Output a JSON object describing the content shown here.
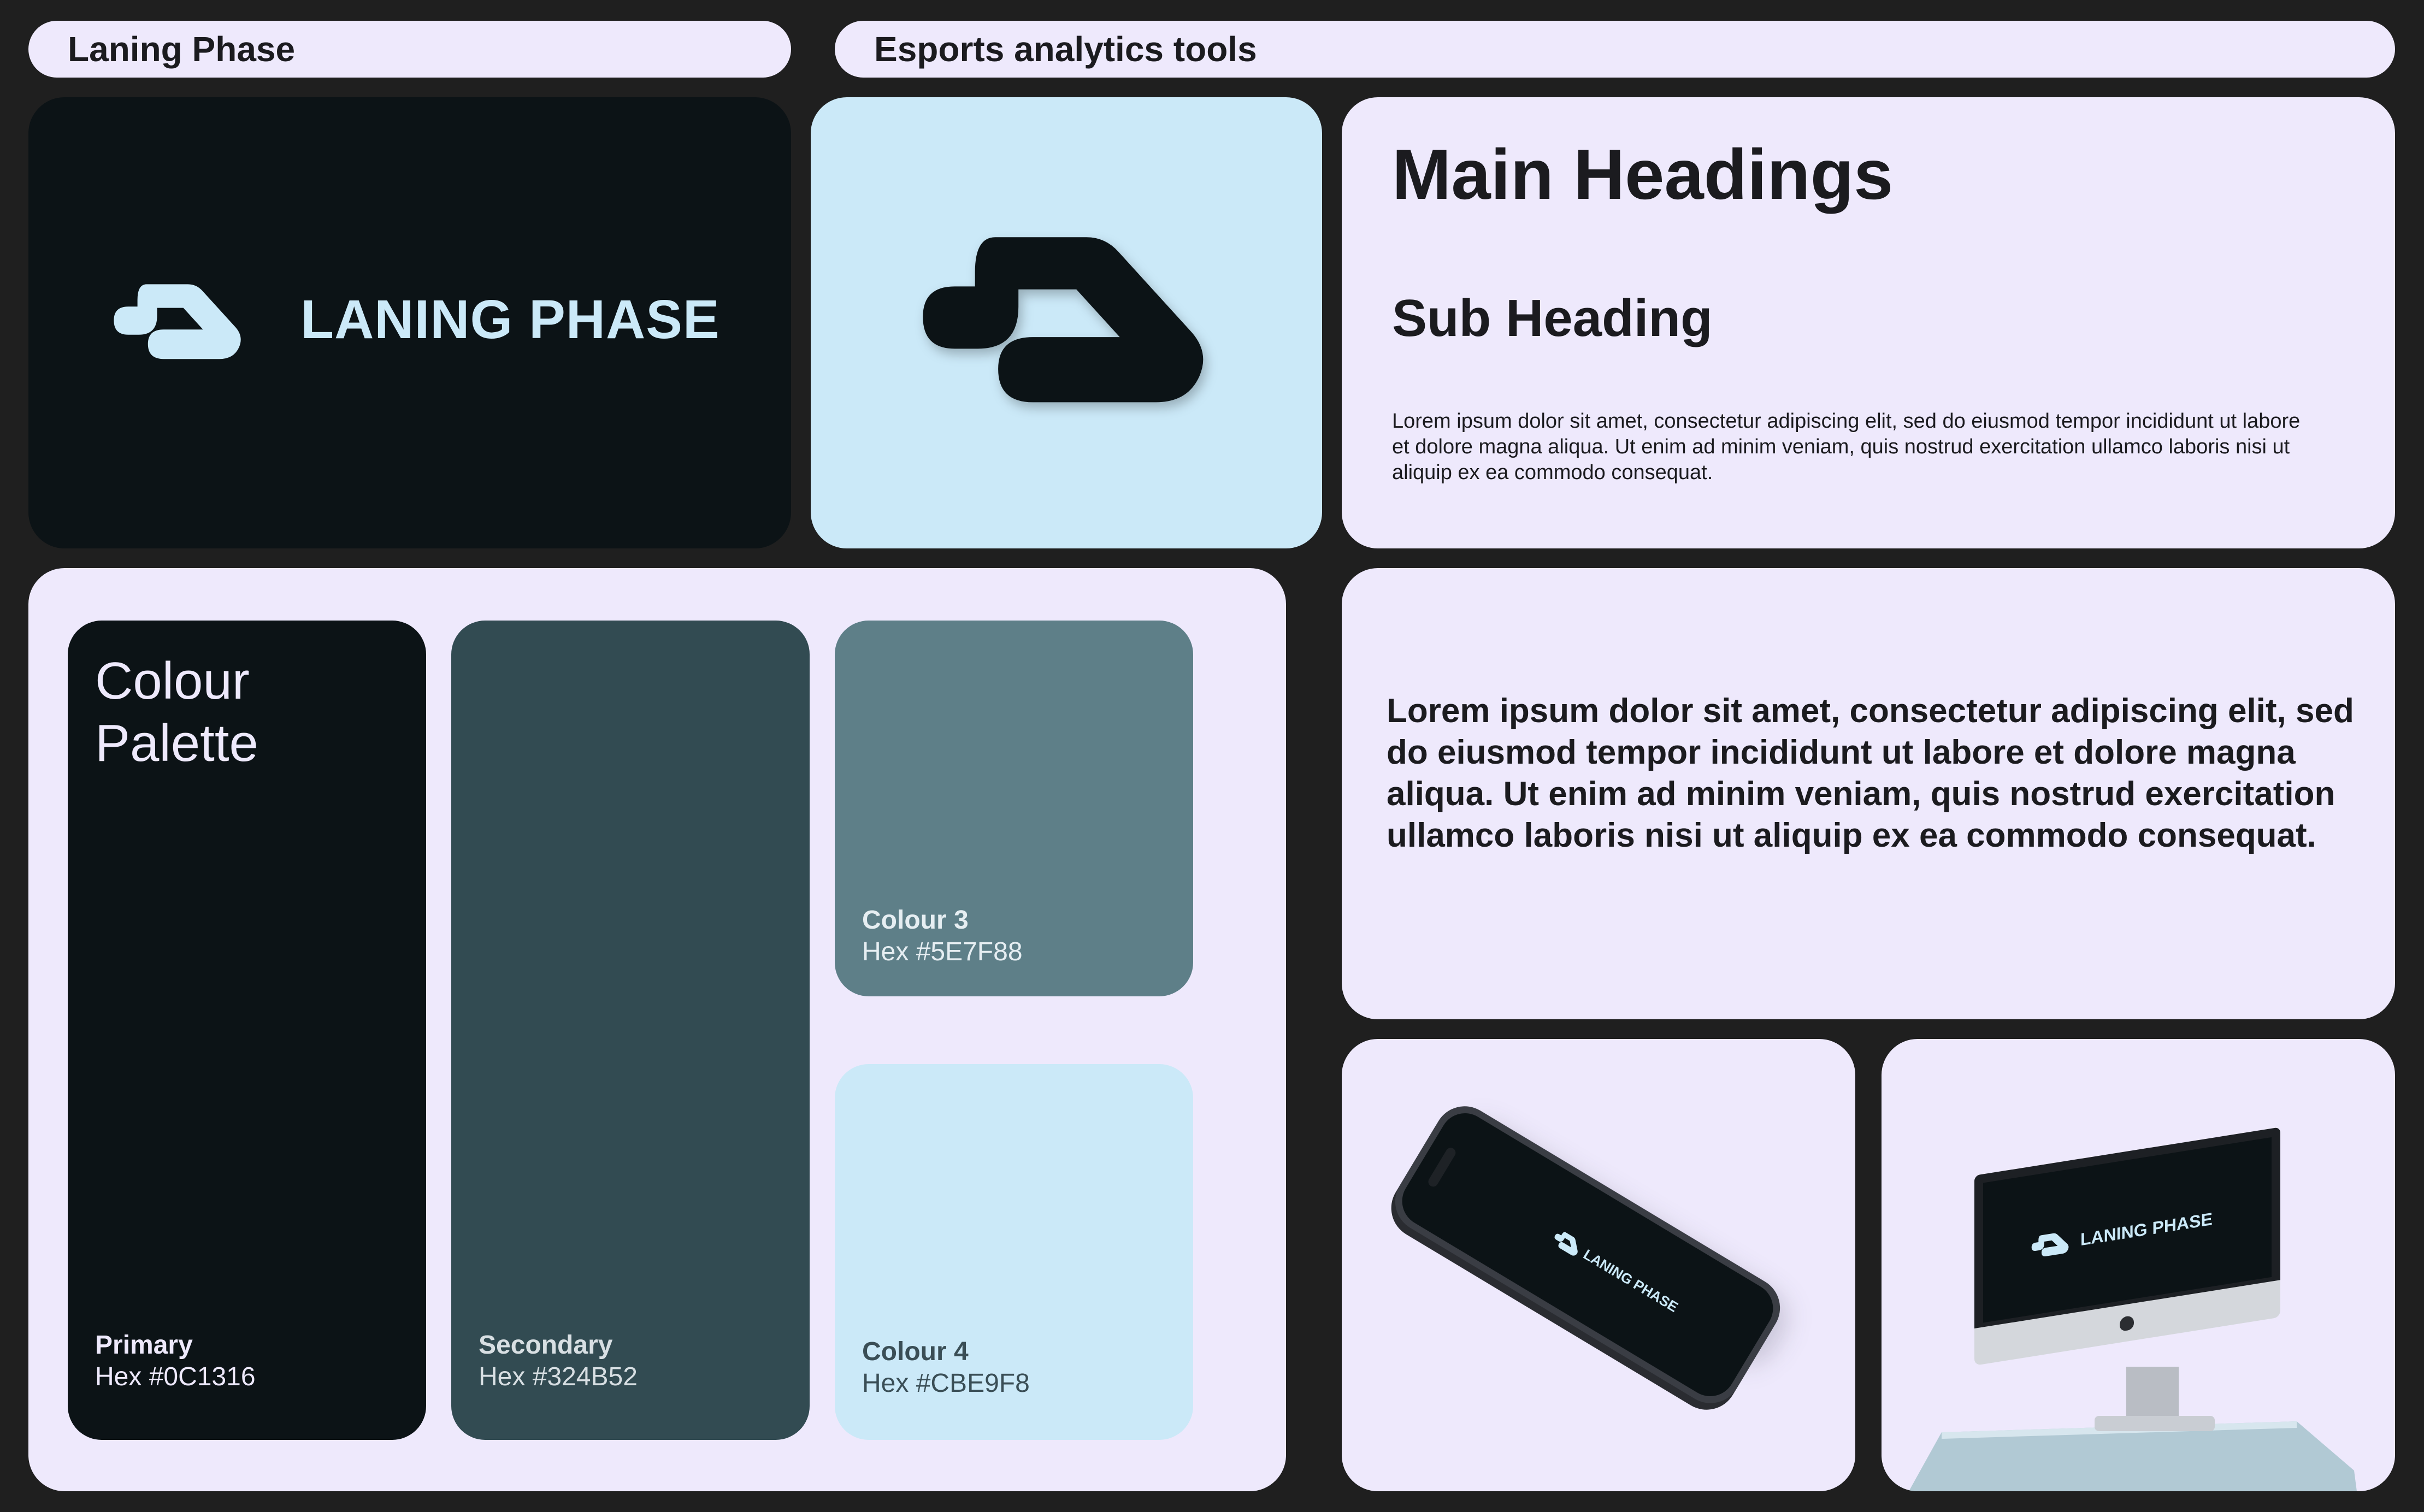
{
  "header": {
    "brand_pill": "Laning Phase",
    "tagline_pill": "Esports analytics tools"
  },
  "logo_card": {
    "wordmark": "LANING PHASE",
    "icon": "laning-phase-logo-icon"
  },
  "icon_card": {
    "icon": "laning-phase-logo-icon"
  },
  "typography": {
    "main_heading": "Main Headings",
    "sub_heading": "Sub Heading",
    "body_text": "Lorem ipsum dolor sit amet, consectetur adipiscing elit, sed do eiusmod tempor incididunt ut labore et dolore magna aliqua. Ut enim ad minim veniam, quis nostrud exercitation ullamco laboris nisi ut aliquip ex ea commodo consequat."
  },
  "palette": {
    "title_line1": "Colour",
    "title_line2": "Palette",
    "colours": [
      {
        "name": "Primary",
        "hex": "Hex #0C1316",
        "color": "#0C1316"
      },
      {
        "name": "Secondary",
        "hex": "Hex #324B52",
        "color": "#324B52"
      },
      {
        "name": "Colour 3",
        "hex": "Hex #5E7F88",
        "color": "#5E7F88"
      },
      {
        "name": "Colour 4",
        "hex": "Hex #CBE9F8",
        "color": "#CBE9F8"
      }
    ]
  },
  "quote_card": {
    "text": "Lorem ipsum dolor sit amet, consectetur adipiscing elit, sed do eiusmod tempor incididunt ut labore et dolore magna aliqua. Ut enim ad minim veniam, quis nostrud exercitation ullamco laboris nisi ut aliquip ex ea commodo consequat."
  },
  "mockups": {
    "phone_wordmark": "LANING PHASE",
    "monitor_wordmark": "LANING PHASE"
  }
}
